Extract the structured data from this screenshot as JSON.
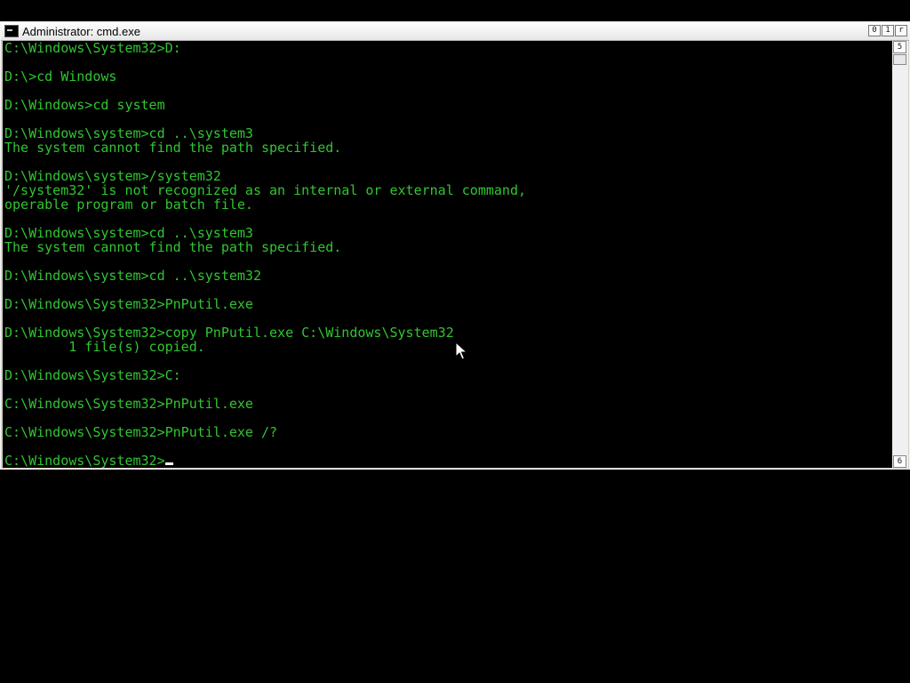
{
  "window": {
    "title": "Administrator: cmd.exe",
    "buttons": {
      "minimize": "0",
      "maximize": "1",
      "close": "r"
    }
  },
  "scrollbar": {
    "up_glyph": "5",
    "down_glyph": "6"
  },
  "console": {
    "text_color": "#31c531",
    "background": "#000000",
    "lines": [
      "C:\\Windows\\System32>D:",
      "",
      "D:\\>cd Windows",
      "",
      "D:\\Windows>cd system",
      "",
      "D:\\Windows\\system>cd ..\\system3",
      "The system cannot find the path specified.",
      "",
      "D:\\Windows\\system>/system32",
      "'/system32' is not recognized as an internal or external command,",
      "operable program or batch file.",
      "",
      "D:\\Windows\\system>cd ..\\system3",
      "The system cannot find the path specified.",
      "",
      "D:\\Windows\\system>cd ..\\system32",
      "",
      "D:\\Windows\\System32>PnPutil.exe",
      "",
      "D:\\Windows\\System32>copy PnPutil.exe C:\\Windows\\System32",
      "        1 file(s) copied.",
      "",
      "D:\\Windows\\System32>C:",
      "",
      "C:\\Windows\\System32>PnPutil.exe",
      "",
      "C:\\Windows\\System32>PnPutil.exe /?",
      ""
    ],
    "prompt": "C:\\Windows\\System32>"
  }
}
